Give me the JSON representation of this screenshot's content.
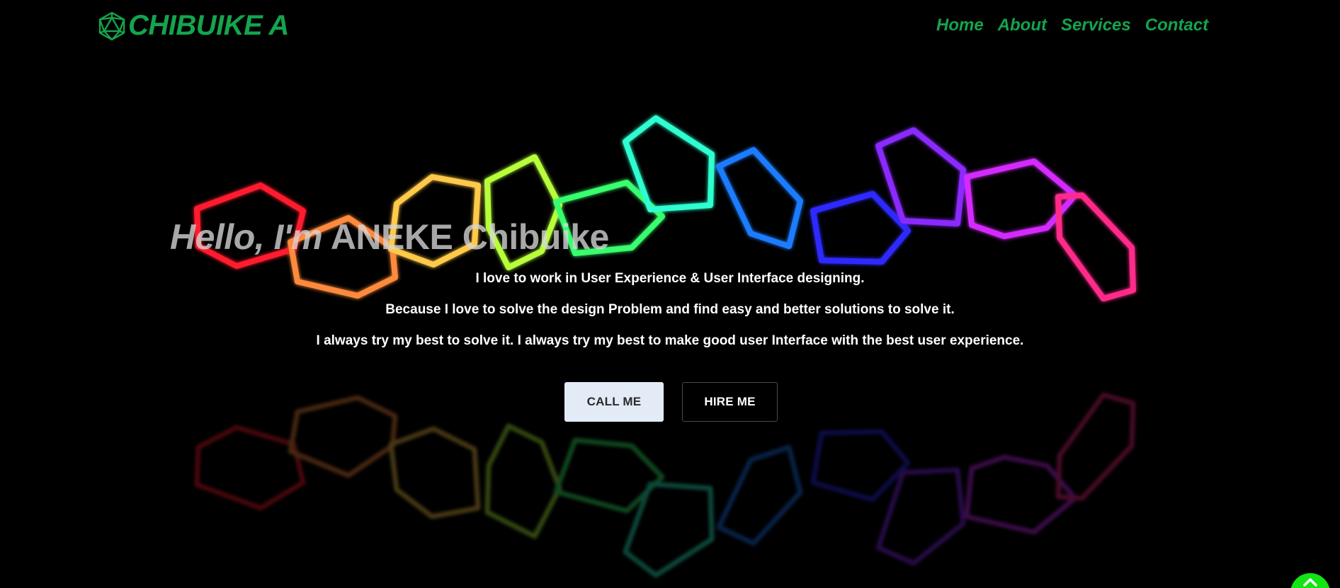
{
  "page": {
    "background": "#000000",
    "accent": "#14a44d"
  },
  "nav": {
    "logo_icon": "d20-dice-icon",
    "logo_text": "CHIBUIKE A",
    "links": [
      {
        "label": "Home"
      },
      {
        "label": "About"
      },
      {
        "label": "Services"
      },
      {
        "label": "Contact"
      }
    ]
  },
  "hero": {
    "greeting": "Hello, I'm",
    "name": "ANEKE Chibuike",
    "lines": [
      "I love to work in User Experience & User Interface designing.",
      "Because I love to solve the design Problem and find easy and better solutions to solve it.",
      "I always try my best to solve it. I always try my best to make good user Interface with the best user experience."
    ],
    "buttons": {
      "call": "Call Me",
      "hire": "Hire Me"
    },
    "background_art": "neon-pentagon-chain",
    "neon_colors": [
      "#ff1a2e",
      "#ff8a3d",
      "#ffc94a",
      "#b8ff3a",
      "#39ff6e",
      "#2effd0",
      "#1e7bff",
      "#2e2bff",
      "#8a2bff",
      "#d42bff",
      "#ff2b8a"
    ]
  },
  "scroll_top": {
    "icon": "chevron-up-icon",
    "color": "#14e314"
  }
}
